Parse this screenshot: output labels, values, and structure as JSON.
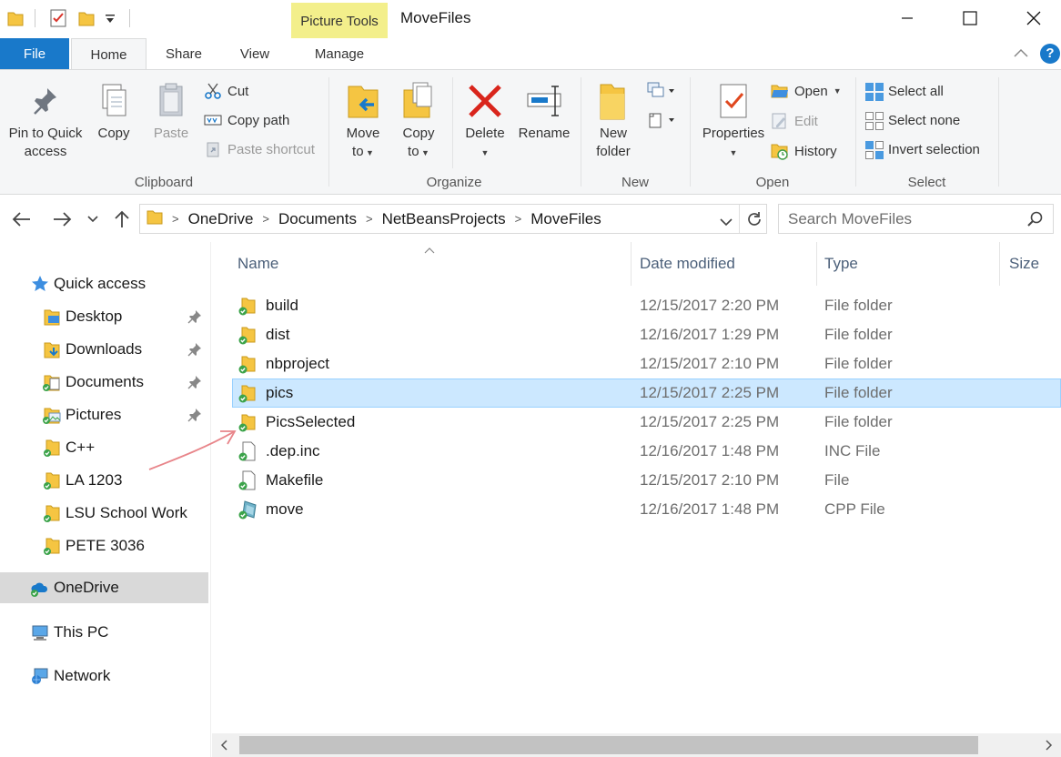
{
  "titlebar": {
    "context_tab": "Picture Tools",
    "title": "MoveFiles"
  },
  "tabs": {
    "file": "File",
    "home": "Home",
    "share": "Share",
    "view": "View",
    "manage": "Manage"
  },
  "ribbon": {
    "clipboard": {
      "pin": "Pin to Quick access",
      "copy": "Copy",
      "paste": "Paste",
      "cut": "Cut",
      "copy_path": "Copy path",
      "paste_shortcut": "Paste shortcut",
      "label": "Clipboard"
    },
    "organize": {
      "move_to": "Move",
      "move_to_2": "to",
      "copy_to": "Copy",
      "copy_to_2": "to",
      "delete": "Delete",
      "rename": "Rename",
      "label": "Organize"
    },
    "new": {
      "new_folder": "New",
      "new_folder_2": "folder",
      "label": "New"
    },
    "open": {
      "properties": "Properties",
      "open": "Open",
      "edit": "Edit",
      "history": "History",
      "label": "Open"
    },
    "select": {
      "select_all": "Select all",
      "select_none": "Select none",
      "invert": "Invert selection",
      "label": "Select"
    }
  },
  "address": {
    "crumbs": [
      "OneDrive",
      "Documents",
      "NetBeansProjects",
      "MoveFiles"
    ],
    "search_placeholder": "Search MoveFiles"
  },
  "navpane": {
    "quick_access": "Quick access",
    "items": [
      "Desktop",
      "Downloads",
      "Documents",
      "Pictures",
      "C++",
      "LA 1203",
      "LSU School Work",
      "PETE 3036"
    ],
    "onedrive": "OneDrive",
    "this_pc": "This PC",
    "network": "Network"
  },
  "columns": {
    "name": "Name",
    "date": "Date modified",
    "type": "Type",
    "size": "Size"
  },
  "files": [
    {
      "name": "build",
      "date": "12/15/2017 2:20 PM",
      "type": "File folder"
    },
    {
      "name": "dist",
      "date": "12/16/2017 1:29 PM",
      "type": "File folder"
    },
    {
      "name": "nbproject",
      "date": "12/15/2017 2:10 PM",
      "type": "File folder"
    },
    {
      "name": "pics",
      "date": "12/15/2017 2:25 PM",
      "type": "File folder"
    },
    {
      "name": "PicsSelected",
      "date": "12/15/2017 2:25 PM",
      "type": "File folder"
    },
    {
      "name": ".dep.inc",
      "date": "12/16/2017 1:48 PM",
      "type": "INC File"
    },
    {
      "name": "Makefile",
      "date": "12/15/2017 2:10 PM",
      "type": "File"
    },
    {
      "name": "move",
      "date": "12/16/2017 1:48 PM",
      "type": "CPP File"
    }
  ],
  "colors": {
    "accent": "#1979ca",
    "folder": "#f5c542",
    "selected_row": "#cce8ff",
    "context_tab": "#f3ef8b",
    "annotation_arrow": "#e8858a"
  }
}
